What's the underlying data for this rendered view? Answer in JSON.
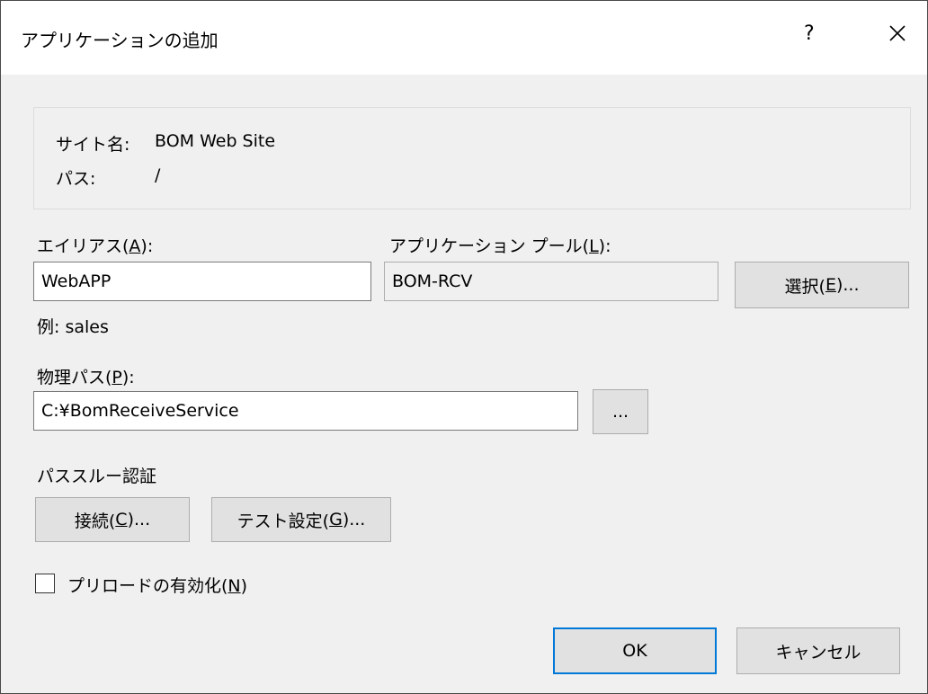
{
  "window": {
    "title": "アプリケーションの追加",
    "help_glyph": "?",
    "close_icon": "close-icon"
  },
  "info": {
    "site_label": "サイト名:",
    "site_value": "BOM Web Site",
    "path_label": "パス:",
    "path_value": "/"
  },
  "alias": {
    "label_prefix": "エイリアス(",
    "label_key": "A",
    "label_suffix": "):",
    "value": "WebAPP",
    "example": "例: sales"
  },
  "app_pool": {
    "label_prefix": "アプリケーション プール(",
    "label_key": "L",
    "label_suffix": "):",
    "value": "BOM-RCV",
    "select_prefix": "選択(",
    "select_key": "E",
    "select_suffix": ")..."
  },
  "physical_path": {
    "label_prefix": "物理パス(",
    "label_key": "P",
    "label_suffix": "):",
    "value": "C:¥BomReceiveService",
    "browse_label": "..."
  },
  "passthrough": {
    "heading": "パススルー認証",
    "connect_prefix": "接続(",
    "connect_key": "C",
    "connect_suffix": ")...",
    "test_prefix": "テスト設定(",
    "test_key": "G",
    "test_suffix": ")..."
  },
  "preload": {
    "label_prefix": "プリロードの有効化(",
    "label_key": "N",
    "label_suffix": ")",
    "checked": false
  },
  "footer": {
    "ok_label": "OK",
    "cancel_label": "キャンセル"
  },
  "colors": {
    "dialog_bg": "#f0f0f0",
    "titlebar_bg": "#ffffff",
    "button_bg": "#e1e1e1",
    "default_button_border": "#0078d7"
  }
}
